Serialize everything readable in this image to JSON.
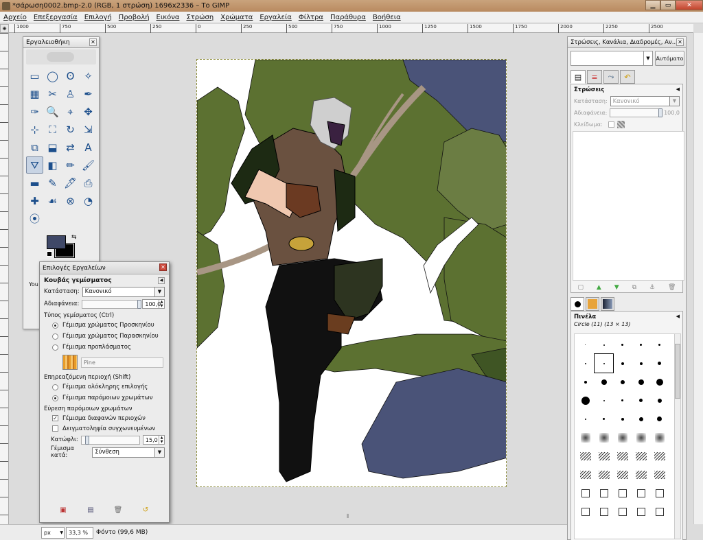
{
  "window": {
    "title": "*σάρωση0002.bmp-2.0 (RGB, 1 στρώση) 1696x2336 – Το GIMP",
    "minimize": "▁",
    "maximize": "▭",
    "close": "✕"
  },
  "menu": [
    "Αρχείο",
    "Επεξεργασία",
    "Επιλογή",
    "Προβολή",
    "Εικόνα",
    "Στρώση",
    "Χρώματα",
    "Εργαλεία",
    "Φίλτρα",
    "Παράθυρα",
    "Βοήθεια"
  ],
  "ruler_labels": [
    "1000",
    "750",
    "500",
    "250",
    "0",
    "250",
    "500",
    "750",
    "1000",
    "1250",
    "1500",
    "1750",
    "2000",
    "2250",
    "2500"
  ],
  "toolbox": {
    "title": "Εργαλειοθήκη",
    "close": "✕",
    "tools": [
      "rect-select",
      "ellipse-select",
      "free-select",
      "fuzzy-select",
      "color-select",
      "scissors-select",
      "foreground-select",
      "paths",
      "color-picker",
      "zoom",
      "measure",
      "move",
      "align",
      "crop",
      "rotate",
      "scale",
      "shear",
      "perspective",
      "flip",
      "text",
      "bucket-fill",
      "blend",
      "pencil",
      "paintbrush",
      "eraser",
      "airbrush",
      "ink",
      "clone",
      "heal",
      "smudge",
      "dodge-burn",
      "smudge2",
      "dodge"
    ],
    "tool_glyphs": [
      "▭",
      "◯",
      "ʘ",
      "✧",
      "▦",
      "✂",
      "♙",
      "✒",
      "✑",
      "🔍",
      "⌖",
      "✥",
      "⊹",
      "⛶",
      "↻",
      "⇲",
      "⧉",
      "⬓",
      "⇄",
      "A",
      "⛛",
      "◧",
      "✏",
      "🖌",
      "▬",
      "✎",
      "🖋",
      "⎙",
      "✚",
      "☙",
      "⊗",
      "◔",
      "⦿"
    ],
    "active_tool_index": 20,
    "fg_color": "#3f4867",
    "bg_color": "#000000",
    "you_label": "You"
  },
  "tool_options": {
    "title": "Επιλογές Εργαλείων",
    "tool_name": "Κουβάς γεμίσματος",
    "mode_label": "Κατάσταση:",
    "mode_value": "Κανονικό",
    "opacity_label": "Αδιαφάνεια:",
    "opacity_value": "100,0",
    "opacity_fraction": 1.0,
    "fill_type_label": "Τύπος γεμίσματος  (Ctrl)",
    "fill_types": [
      "Γέμισμα χρώματος Προσκηνίου",
      "Γέμισμα χρώματος Παρασκηνίου",
      "Γέμισμα προπλάσματος"
    ],
    "fill_type_selected": 0,
    "pattern_name": "Pine",
    "affected_label": "Επηρεαζόμενη περιοχή  (Shift)",
    "affected": [
      "Γέμισμα ολόκληρης επιλογής",
      "Γέμισμα παρόμοιων χρωμάτων"
    ],
    "affected_selected": 1,
    "similar_label": "Εύρεση παρόμοιων χρωμάτων",
    "checks": [
      {
        "label": "Γέμισμα διαφανών περιοχών",
        "checked": true
      },
      {
        "label": "Δειγματοληψία συγχωνευμένων",
        "checked": false
      }
    ],
    "threshold_label": "Κατώφλι:",
    "threshold_value": "15,0",
    "threshold_fraction": 0.06,
    "fill_by_label": "Γέμισμα κατά:",
    "fill_by_value": "Σύνθεση"
  },
  "dock": {
    "title": "Στρώσεις, Κανάλια, Διαδρομές, Αν...",
    "auto_button": "Αυτόματο",
    "layers_title": "Στρώσεις",
    "mode_label": "Κατάσταση:",
    "mode_value": "Κανονικό",
    "opacity_label": "Αδιαφάνεια:",
    "opacity_value": "100,0",
    "lock_label": "Κλείδωμα:",
    "brushes_title": "Πινέλα",
    "brush_name": "Circle (11) (13 × 13)"
  },
  "status": {
    "unit": "px",
    "zoom": "33,3 %",
    "text": "Φόντο (99,6 MB)"
  }
}
